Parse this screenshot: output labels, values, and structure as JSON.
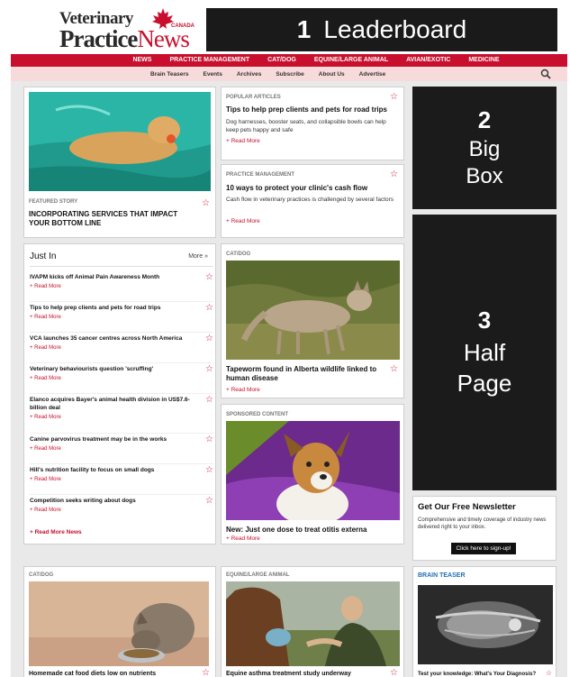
{
  "header": {
    "logo_line1": "Veterinary",
    "logo_practice": "Practice",
    "logo_news": "News",
    "logo_canada": "CANADA",
    "leaderboard_number": "1",
    "leaderboard_label": "Leaderboard"
  },
  "nav": {
    "items": [
      "NEWS",
      "PRACTICE MANAGEMENT",
      "CAT/DOG",
      "EQUINE/LARGE ANIMAL",
      "AVIAN/EXOTIC",
      "MEDICINE"
    ]
  },
  "subnav": {
    "items": [
      "Brain Teasers",
      "Events",
      "Archives",
      "Subscribe",
      "About Us",
      "Advertise"
    ]
  },
  "featured": {
    "category": "FEATURED STORY",
    "headline": "INCORPORATING SERVICES THAT IMPACT YOUR BOTTOM LINE"
  },
  "popular": {
    "category": "POPULAR ARTICLES",
    "headline": "Tips to help prep clients and pets for road trips",
    "desc": "Dog harnesses, booster seats, and collapsible bowls can help keep pets happy and safe",
    "more": "+ Read More"
  },
  "practice": {
    "category": "PRACTICE MANAGEMENT",
    "headline": "10 ways to protect your clinic's cash flow",
    "desc": "Cash flow in veterinary practices is challenged by several factors",
    "more": "+ Read More"
  },
  "ads": {
    "big_number": "2",
    "big_line1": "Big",
    "big_line2": "Box",
    "half_number": "3",
    "half_line1": "Half",
    "half_line2": "Page"
  },
  "just_in": {
    "title": "Just In",
    "more": "More »",
    "items": [
      {
        "title": "IVAPM kicks off Animal Pain Awareness Month",
        "more": "+ Read More"
      },
      {
        "title": "Tips to help prep clients and pets for road trips",
        "more": "+ Read More"
      },
      {
        "title": "VCA launches 35 cancer centres across North America",
        "more": "+ Read More"
      },
      {
        "title": "Veterinary behaviourists question 'scruffing'",
        "more": "+ Read More"
      },
      {
        "title": "Elanco acquires Bayer's animal health division in US$7.6-billion deal",
        "more": "+ Read More"
      },
      {
        "title": "Canine parvovirus treatment may be in the works",
        "more": "+ Read More"
      },
      {
        "title": "Hill's nutrition facility to focus on small dogs",
        "more": "+ Read More"
      },
      {
        "title": "Competition seeks writing about dogs",
        "more": "+ Read More"
      }
    ],
    "read_more_news": "+ Read More News"
  },
  "catdog": {
    "category": "CAT/DOG",
    "headline": "Tapeworm found in Alberta wildlife linked to human disease",
    "more": "+ Read More"
  },
  "sponsored": {
    "category": "SPONSORED CONTENT",
    "headline": "New: Just one dose to treat otitis externa",
    "more": "+ Read More"
  },
  "newsletter": {
    "title": "Get Our Free Newsletter",
    "desc": "Comprehensive and timely coverage of industry news delivered right to your inbox.",
    "button": "Click here to sign-up!"
  },
  "bottom": {
    "cat1": "CAT/DOG",
    "head1": "Homemade cat food diets low on nutrients",
    "cat2": "EQUINE/LARGE ANIMAL",
    "head2": "Equine asthma treatment study underway",
    "cat3": "BRAIN TEASER",
    "head3": "Test your knowledge: What's Your Diagnosis?"
  },
  "colors": {
    "brand_red": "#c8102e",
    "subnav_pink": "#f7dada",
    "ad_dark": "#1b1b1b"
  }
}
